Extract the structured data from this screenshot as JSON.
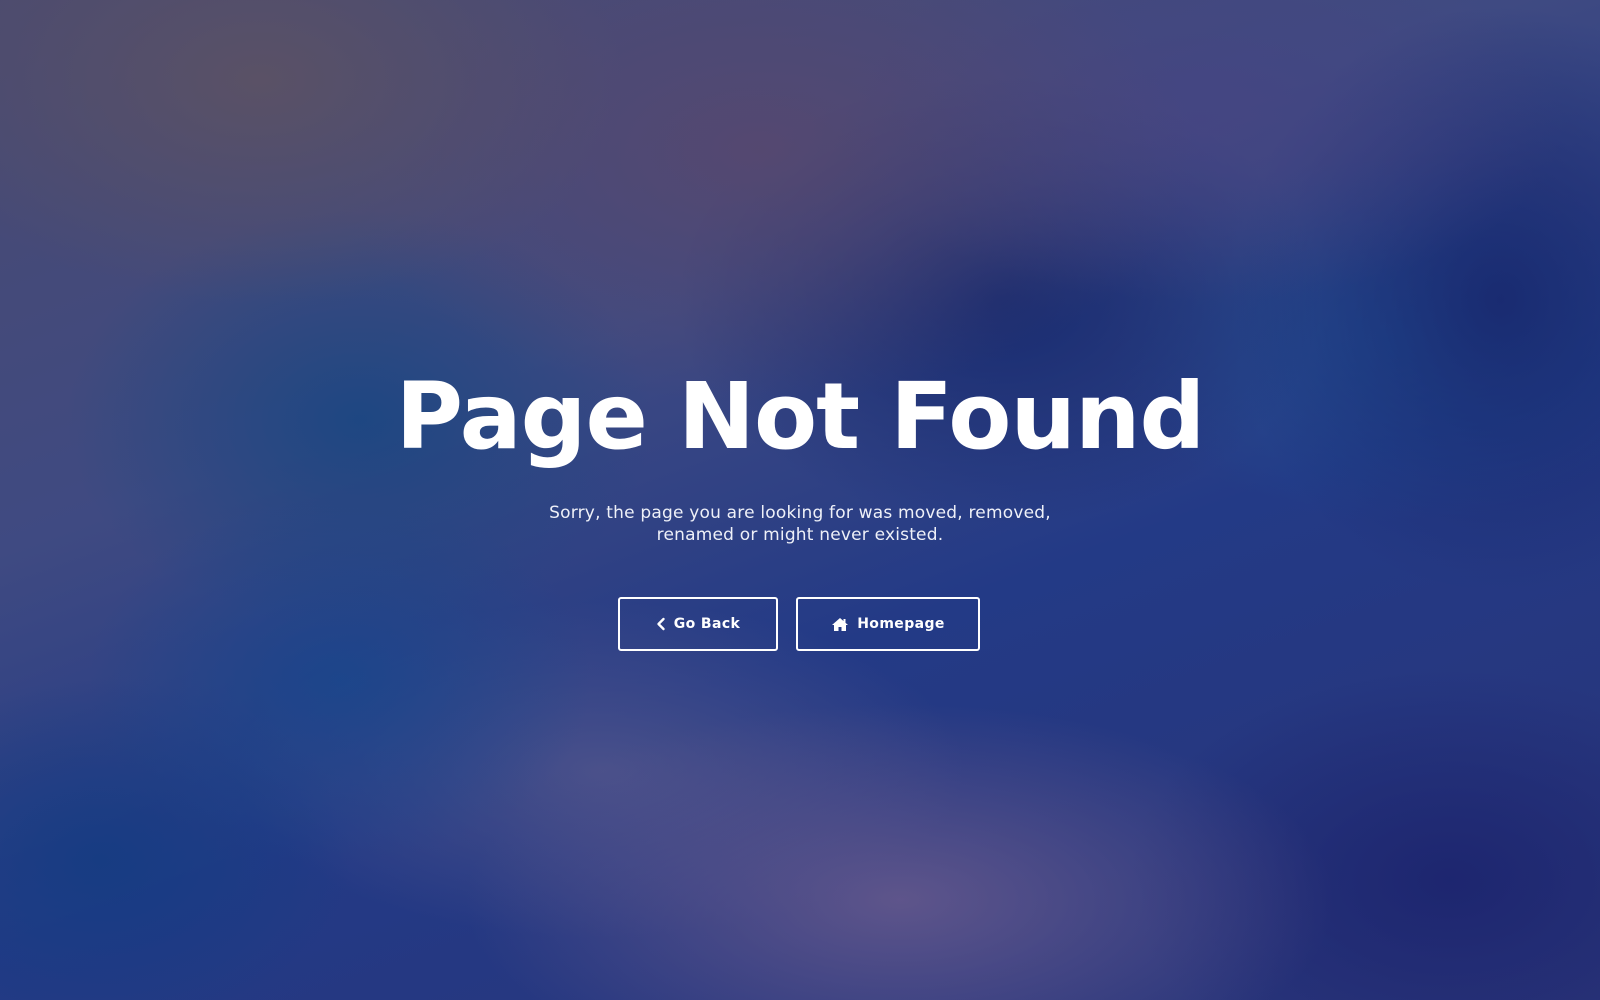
{
  "page": {
    "title": "Page Not Found",
    "message": "Sorry, the page you are looking for was moved, removed, renamed or might never existed."
  },
  "actions": {
    "back": {
      "label": "Go Back",
      "icon": "chevron-left-icon"
    },
    "home": {
      "label": "Homepage",
      "icon": "home-icon"
    }
  },
  "colors": {
    "text": "#ffffff",
    "button_border": "#ffffff",
    "background_primary": "#233a86",
    "background_secondary": "#4a4a70"
  }
}
